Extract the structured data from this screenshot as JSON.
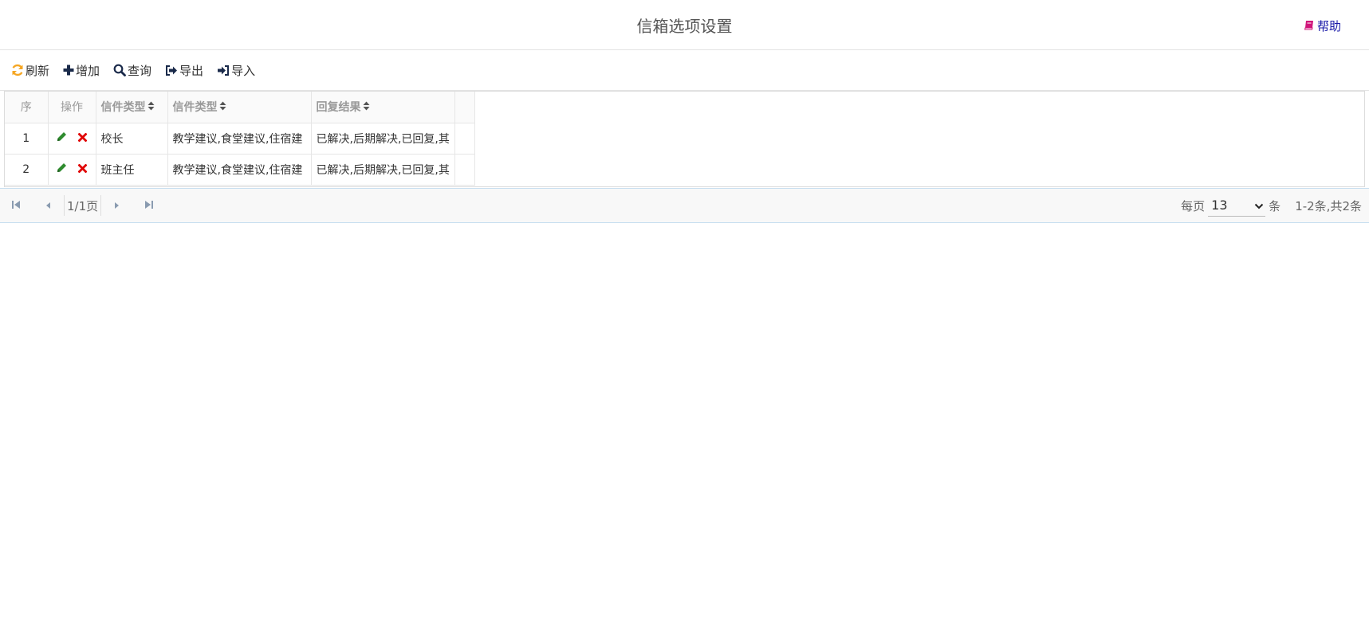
{
  "header": {
    "title": "信箱选项设置",
    "help_label": "帮助"
  },
  "toolbar": {
    "refresh_label": "刷新",
    "add_label": "增加",
    "query_label": "查询",
    "export_label": "导出",
    "import_label": "导入"
  },
  "grid": {
    "columns": {
      "seq": "序",
      "ops": "操作",
      "col1": "信件类型",
      "col2": "信件类型",
      "col3": "回复结果"
    },
    "rows": [
      {
        "seq": "1",
        "col1": "校长",
        "col2": "教学建议,食堂建议,住宿建",
        "col3": "已解决,后期解决,已回复,其"
      },
      {
        "seq": "2",
        "col1": "班主任",
        "col2": "教学建议,食堂建议,住宿建",
        "col3": "已解决,后期解决,已回复,其"
      }
    ]
  },
  "pager": {
    "page_info": "1/1页",
    "per_page_prefix": "每页",
    "per_page_value": "13",
    "per_page_suffix": "条",
    "total_info": "1-2条,共2条"
  },
  "colors": {
    "refresh_icon": "#f5a623",
    "edit_icon": "#2e8b2e",
    "delete_icon": "#e00000",
    "help_icon": "#d0157a",
    "toolbar_icon": "#1a2a4a"
  }
}
